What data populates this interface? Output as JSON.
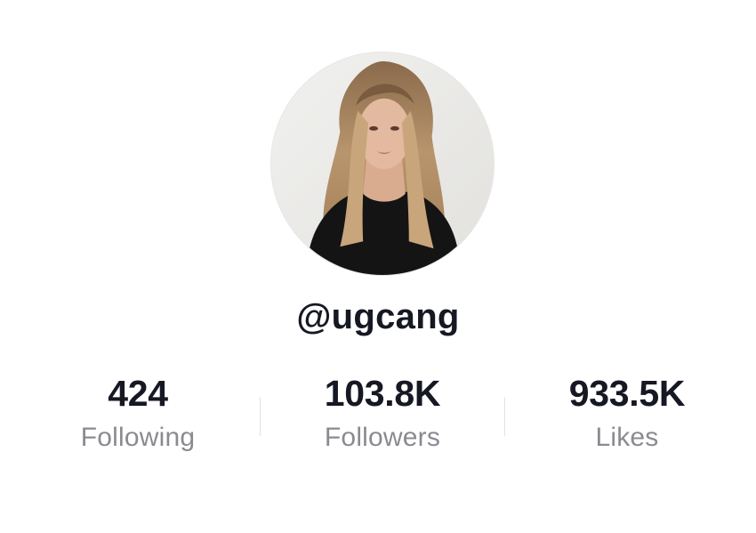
{
  "profile": {
    "username": "@ugcang",
    "avatar_icon": "profile-photo"
  },
  "stats": [
    {
      "value": "424",
      "label": "Following"
    },
    {
      "value": "103.8K",
      "label": "Followers"
    },
    {
      "value": "933.5K",
      "label": "Likes"
    }
  ],
  "colors": {
    "text_primary": "#161823",
    "text_secondary": "#8a8b91",
    "divider": "#e3e3e4",
    "background": "#ffffff"
  }
}
